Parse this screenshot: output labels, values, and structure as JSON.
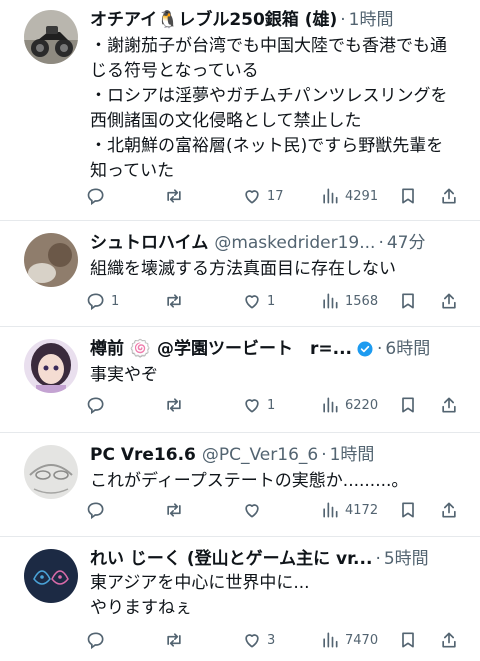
{
  "tweets": [
    {
      "name": "オチアイ🐧レブル250銀箱 (雄)",
      "handle": "",
      "time": "1時間",
      "verified": false,
      "lines": [
        "・謝謝茄子が台湾でも中国大陸でも香港でも通",
        "じる符号となっている",
        "・ロシアは淫夢やガチムチパンツレスリングを",
        "西側諸国の文化侵略として禁止した",
        "・北朝鮮の富裕層(ネット民)ですら野獣先輩を",
        "知っていた"
      ],
      "replies": "",
      "retweets": "",
      "likes": "17",
      "views": "4291"
    },
    {
      "name": "シュトロハイム",
      "handle": "@maskedrider19...",
      "time": "47分",
      "verified": false,
      "lines": [
        "組織を壊滅する方法真面目に存在しない"
      ],
      "replies": "1",
      "retweets": "",
      "likes": "1",
      "views": "1568"
    },
    {
      "name": "樽前 🍥 @学園ツービート　r=...",
      "handle": "",
      "time": "6時間",
      "verified": true,
      "lines": [
        "事実やぞ"
      ],
      "replies": "",
      "retweets": "",
      "likes": "1",
      "views": "6220"
    },
    {
      "name": "PC Vre16.6",
      "handle": "@PC_Ver16_6",
      "time": "1時間",
      "verified": false,
      "lines": [
        "これがディープステートの実態か.........。"
      ],
      "replies": "",
      "retweets": "",
      "likes": "",
      "views": "4172"
    },
    {
      "name": "れい じーく (登山とゲーム主に vr...",
      "handle": "",
      "time": "5時間",
      "verified": false,
      "lines": [
        "東アジアを中心に世界中に...",
        "やりますねぇ"
      ],
      "replies": "",
      "retweets": "",
      "likes": "3",
      "views": "7470"
    }
  ],
  "separator": "·",
  "colors": {
    "text": "#0f1419",
    "secondary": "#536471",
    "divider": "#e6e9ec",
    "verified_blue": "#1d9bf0"
  },
  "icons": [
    "reply-icon",
    "retweet-icon",
    "like-icon",
    "views-icon",
    "bookmark-icon",
    "share-icon",
    "verified-icon"
  ]
}
